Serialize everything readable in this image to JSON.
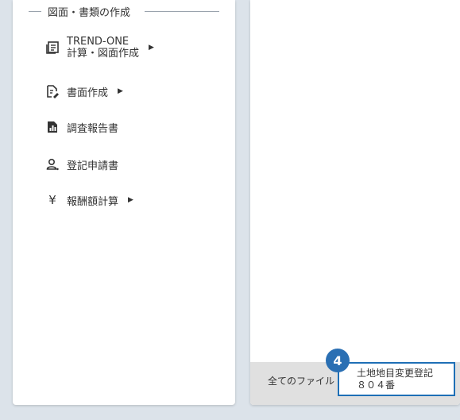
{
  "sidebar": {
    "section_title": "図面・書類の作成",
    "items": [
      {
        "label_line1": "TREND-ONE",
        "label_line2": "計算・図面作成",
        "icon": "document-list-icon",
        "has_submenu": true
      },
      {
        "label": "書面作成",
        "icon": "document-edit-icon",
        "has_submenu": true
      },
      {
        "label": "調査報告書",
        "icon": "report-chart-icon",
        "has_submenu": false
      },
      {
        "label": "登記申請書",
        "icon": "person-apply-icon",
        "has_submenu": false
      },
      {
        "label": "報酬額計算",
        "icon": "yen-icon",
        "has_submenu": true
      }
    ]
  },
  "file_tabs": {
    "all_files_label": "全てのファイル",
    "active_tab_line1": "土地地目変更登記",
    "active_tab_line2": "８０４番"
  },
  "callout": {
    "number": "4"
  },
  "colors": {
    "accent": "#1e6fb6",
    "badge": "#2a6fb3",
    "background": "#dce3ea"
  }
}
